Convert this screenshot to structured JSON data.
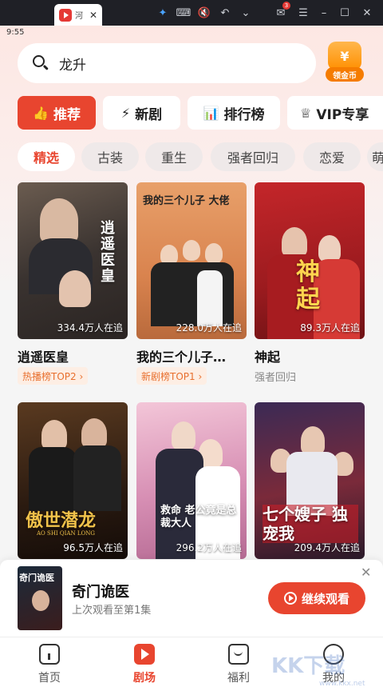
{
  "emulator": {
    "tab_title": "河",
    "tab_close": "✕",
    "mail_badge": "3"
  },
  "status": {
    "time": "9:55"
  },
  "search": {
    "query": "龙升"
  },
  "gold": {
    "coin_symbol": "¥",
    "label": "领金币"
  },
  "categories": [
    {
      "icon": "👍",
      "label": "推荐"
    },
    {
      "icon": "⚡",
      "label": "新剧"
    },
    {
      "icon": "📊",
      "label": "排行榜"
    },
    {
      "icon": "♕",
      "label": "VIP专享"
    }
  ],
  "chips": [
    "精选",
    "古装",
    "重生",
    "强者回归",
    "恋爱",
    "萌"
  ],
  "dramas": [
    {
      "title": "逍遥医皇",
      "views": "334.4万人在追",
      "tag": "热播榜TOP2 ›",
      "poster_text": "逍遥医皇"
    },
    {
      "title": "我的三个儿子…",
      "views": "228.0万人在追",
      "tag": "新剧榜TOP1 ›",
      "poster_text": "我的三个儿子 大佬"
    },
    {
      "title": "神起",
      "views": "89.3万人在追",
      "sub": "强者回归",
      "poster_text": "神起"
    },
    {
      "views": "96.5万人在追",
      "poster_text": "傲世潜龙",
      "poster_sub": "AO SHI QIAN LONG"
    },
    {
      "views": "296.2万人在追",
      "poster_text": "救命 老公竟是总裁大人"
    },
    {
      "views": "209.4万人在追",
      "poster_text": "七个嫂子 独宠我"
    }
  ],
  "continue": {
    "thumb_text": "奇门诡医",
    "title": "奇门诡医",
    "subtitle": "上次观看至第1集",
    "button": "继续观看",
    "close": "✕"
  },
  "nav": [
    {
      "label": "首页"
    },
    {
      "label": "剧场"
    },
    {
      "label": "福利"
    },
    {
      "label": "我的"
    }
  ],
  "watermark": {
    "text": "KK下载",
    "url": "www.kkx.net"
  },
  "colors": {
    "accent": "#e8452f",
    "tag_text": "#e8702f",
    "gold": "#f57c00"
  }
}
